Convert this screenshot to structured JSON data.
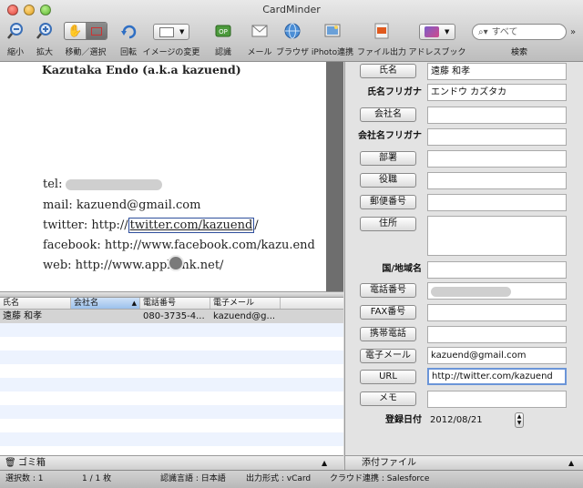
{
  "window": {
    "title": "CardMinder"
  },
  "toolbar": {
    "zoom_out": "縮小",
    "zoom_in": "拡大",
    "move_select": "移動／選択",
    "rotate": "回転",
    "change_image": "イメージの変更",
    "recognize": "認識",
    "mail": "メール",
    "browser": "ブラウザ",
    "iphoto": "iPhoto連携",
    "file_output": "ファイル出力",
    "address_book": "アドレスブック",
    "search_placeholder": "すべて",
    "search_label": "検索"
  },
  "card": {
    "name": "Kazutaka Endo (a.k.a kazuend)",
    "tel_label": "tel:",
    "mail": "mail: kazuend@gmail.com",
    "twitter_prefix": "twitter: http://",
    "twitter_selected": "twitter.com/kazuend",
    "twitter_suffix": "/",
    "facebook": "facebook: http://www.facebook.com/kazu.end",
    "web": "web: http://www.appbank.net/"
  },
  "table": {
    "headers": [
      "氏名",
      "会社名",
      "電話番号",
      "電子メール",
      ""
    ],
    "rows": [
      [
        "遠藤 和孝",
        "",
        "080-3735-4...",
        "kazuend@g...",
        ""
      ]
    ]
  },
  "trash": {
    "label": "ゴミ箱"
  },
  "form": {
    "name_btn": "氏名",
    "name_value": "遠藤 和孝",
    "name_kana_label": "氏名フリガナ",
    "name_kana_value": "エンドウ カズタカ",
    "company_btn": "会社名",
    "company_kana_label": "会社名フリガナ",
    "dept_btn": "部署",
    "title_btn": "役職",
    "zip_btn": "郵便番号",
    "address_btn": "住所",
    "country_label": "国/地域名",
    "phone_btn": "電話番号",
    "fax_btn": "FAX番号",
    "mobile_btn": "携帯電話",
    "email_btn": "電子メール",
    "email_value": "kazuend@gmail.com",
    "url_btn": "URL",
    "url_value": "http://twitter.com/kazuend",
    "memo_btn": "メモ",
    "date_label": "登録日付",
    "date_value": "2012/08/21"
  },
  "attach": {
    "label": "添付ファイル"
  },
  "status": {
    "selected": "選択数 : 1",
    "count": "1 / 1 枚",
    "language": "認識言語 : 日本語",
    "output": "出力形式 : vCard",
    "cloud": "クラウド連携 : Salesforce"
  }
}
